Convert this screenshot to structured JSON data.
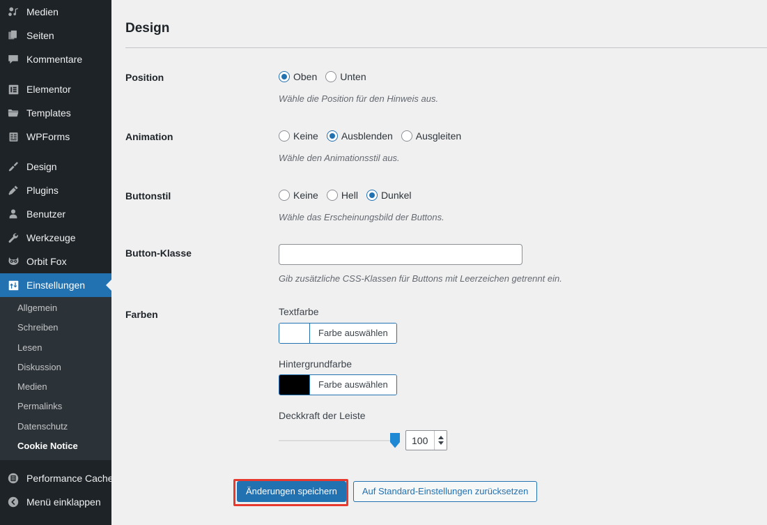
{
  "sidebar": {
    "items": [
      {
        "label": "Medien",
        "icon": "media-icon",
        "active": false,
        "sep_after": false
      },
      {
        "label": "Seiten",
        "icon": "pages-icon",
        "active": false,
        "sep_after": false
      },
      {
        "label": "Kommentare",
        "icon": "comments-icon",
        "active": false,
        "sep_after": true
      },
      {
        "label": "Elementor",
        "icon": "elementor-icon",
        "active": false,
        "sep_after": false
      },
      {
        "label": "Templates",
        "icon": "templates-icon",
        "active": false,
        "sep_after": false
      },
      {
        "label": "WPForms",
        "icon": "wpforms-icon",
        "active": false,
        "sep_after": true
      },
      {
        "label": "Design",
        "icon": "appearance-icon",
        "active": false,
        "sep_after": false
      },
      {
        "label": "Plugins",
        "icon": "plugins-icon",
        "active": false,
        "sep_after": false
      },
      {
        "label": "Benutzer",
        "icon": "users-icon",
        "active": false,
        "sep_after": false
      },
      {
        "label": "Werkzeuge",
        "icon": "tools-icon",
        "active": false,
        "sep_after": false
      },
      {
        "label": "Orbit Fox",
        "icon": "fox-icon",
        "active": false,
        "sep_after": false
      },
      {
        "label": "Einstellungen",
        "icon": "settings-icon",
        "active": true,
        "sep_after": false
      }
    ],
    "submenu": [
      {
        "label": "Allgemein",
        "current": false
      },
      {
        "label": "Schreiben",
        "current": false
      },
      {
        "label": "Lesen",
        "current": false
      },
      {
        "label": "Diskussion",
        "current": false
      },
      {
        "label": "Medien",
        "current": false
      },
      {
        "label": "Permalinks",
        "current": false
      },
      {
        "label": "Datenschutz",
        "current": false
      },
      {
        "label": "Cookie Notice",
        "current": true
      }
    ],
    "footer_items": [
      {
        "label": "Performance Cache",
        "icon": "performance-cache-icon"
      },
      {
        "label": "Menü einklappen",
        "icon": "collapse-icon"
      }
    ]
  },
  "main": {
    "page_title": "Design",
    "rows": {
      "position": {
        "label": "Position",
        "options": [
          {
            "label": "Oben",
            "checked": true
          },
          {
            "label": "Unten",
            "checked": false
          }
        ],
        "hint": "Wähle die Position für den Hinweis aus."
      },
      "animation": {
        "label": "Animation",
        "options": [
          {
            "label": "Keine",
            "checked": false
          },
          {
            "label": "Ausblenden",
            "checked": true
          },
          {
            "label": "Ausgleiten",
            "checked": false
          }
        ],
        "hint": "Wähle den Animationsstil aus."
      },
      "button_style": {
        "label": "Buttonstil",
        "options": [
          {
            "label": "Keine",
            "checked": false
          },
          {
            "label": "Hell",
            "checked": false
          },
          {
            "label": "Dunkel",
            "checked": true
          }
        ],
        "hint": "Wähle das Erscheinungsbild der Buttons."
      },
      "button_class": {
        "label": "Button-Klasse",
        "value": "",
        "placeholder": "",
        "hint": "Gib zusätzliche CSS-Klassen für Buttons mit Leerzeichen getrennt ein."
      },
      "colors": {
        "label": "Farben",
        "text_color": {
          "label": "Textfarbe",
          "button_label": "Farbe auswählen",
          "swatch": "#ffffff"
        },
        "background_color": {
          "label": "Hintergrundfarbe",
          "button_label": "Farbe auswählen",
          "swatch": "#000000"
        },
        "opacity": {
          "label": "Deckkraft der Leiste",
          "value": "100"
        }
      }
    },
    "buttons": {
      "save": "Änderungen speichern",
      "reset": "Auf Standard-Einstellungen zurücksetzen"
    }
  },
  "theme": {
    "sidebar_bg": "#1d2327",
    "submenu_bg": "#2c3338",
    "accent": "#2271b1",
    "content_bg": "#f0f0f1",
    "highlight": "#e8392e"
  }
}
